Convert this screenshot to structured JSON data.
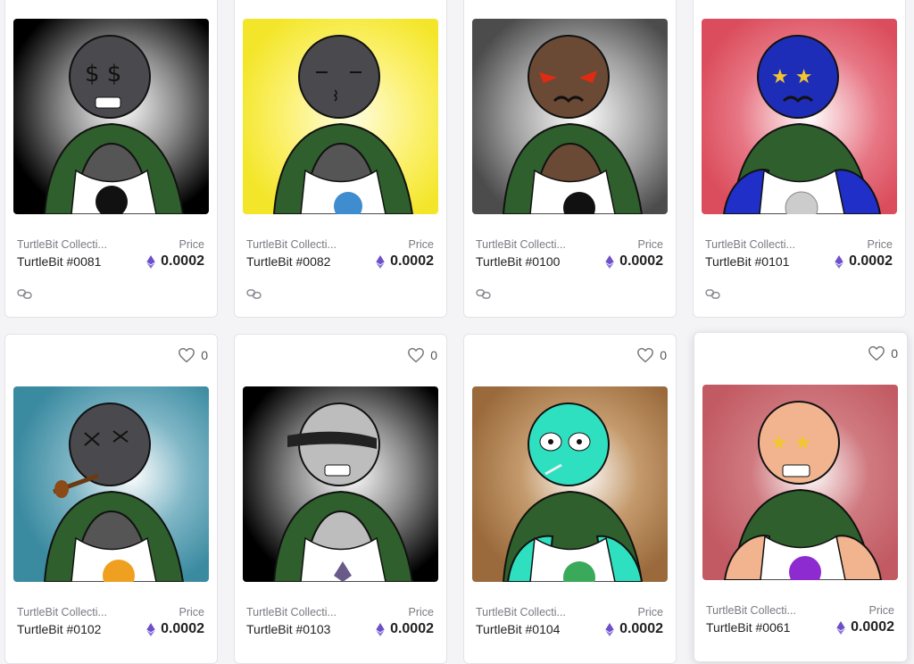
{
  "currency_icon": "ethereum-icon",
  "like_icon": "heart-outline-icon",
  "link_icon": "link-chain-icon",
  "colors": {
    "eth": "#6c4fc9",
    "shell": "#2f5f2c",
    "border": "#e3e3e8"
  },
  "row1": [
    {
      "collection": "TurtleBit Collecti...",
      "price_label": "Price",
      "name": "TurtleBit #0081",
      "price": "0.0002"
    },
    {
      "collection": "TurtleBit Collecti...",
      "price_label": "Price",
      "name": "TurtleBit #0082",
      "price": "0.0002"
    },
    {
      "collection": "TurtleBit Collecti...",
      "price_label": "Price",
      "name": "TurtleBit #0100",
      "price": "0.0002"
    },
    {
      "collection": "TurtleBit Collecti...",
      "price_label": "Price",
      "name": "TurtleBit #0101",
      "price": "0.0002"
    }
  ],
  "row2": [
    {
      "likes": "0",
      "collection": "TurtleBit Collecti...",
      "price_label": "Price",
      "name": "TurtleBit #0102",
      "price": "0.0002"
    },
    {
      "likes": "0",
      "collection": "TurtleBit Collecti...",
      "price_label": "Price",
      "name": "TurtleBit #0103",
      "price": "0.0002"
    },
    {
      "likes": "0",
      "collection": "TurtleBit Collecti...",
      "price_label": "Price",
      "name": "TurtleBit #0104",
      "price": "0.0002"
    },
    {
      "likes": "0",
      "collection": "TurtleBit Collecti...",
      "price_label": "Price",
      "name": "TurtleBit #0061",
      "price": "0.0002"
    }
  ]
}
